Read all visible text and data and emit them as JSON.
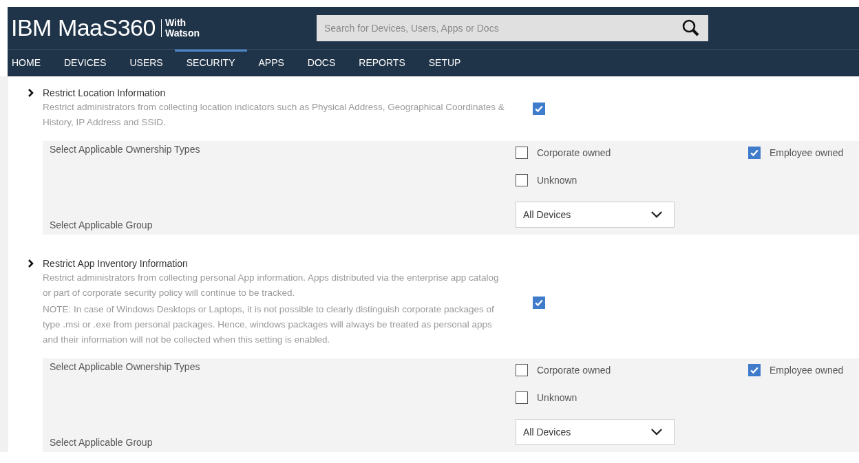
{
  "header": {
    "logo": "IBM MaaS360",
    "logo_sub": [
      "With",
      "Watson"
    ],
    "search": {
      "placeholder": "Search for Devices, Users, Apps or Docs"
    }
  },
  "nav": [
    {
      "label": "HOME",
      "selected": false
    },
    {
      "label": "DEVICES",
      "selected": false
    },
    {
      "label": "USERS",
      "selected": false
    },
    {
      "label": "SECURITY",
      "selected": true
    },
    {
      "label": "APPS",
      "selected": false
    },
    {
      "label": "DOCS",
      "selected": false
    },
    {
      "label": "REPORTS",
      "selected": false
    },
    {
      "label": "SETUP",
      "selected": false
    }
  ],
  "settings": [
    {
      "title": "Restrict Location Information",
      "description": [
        "Restrict administrators from collecting location indicators such as Physical Address, Geographical Coordinates & History, IP Address and SSID."
      ],
      "checked": true,
      "ownership_label": "Select Applicable Ownership Types",
      "ownership": [
        {
          "label": "Corporate owned",
          "checked": false
        },
        {
          "label": "Employee owned",
          "checked": true
        },
        {
          "label": "Unknown",
          "checked": false
        }
      ],
      "group_label": "Select Applicable Group",
      "group": "All Devices"
    },
    {
      "title": "Restrict App Inventory Information",
      "description": [
        "Restrict administrators from collecting personal App information. Apps distributed via the enterprise app catalog or part of corporate security policy will continue to be tracked.",
        "NOTE: In case of Windows Desktops or Laptops, it is not possible to clearly distinguish corporate packages of type .msi or .exe from personal packages. Hence, windows packages will always be treated as personal apps and their information will not be collected when this setting is enabled."
      ],
      "checked": true,
      "ownership_label": "Select Applicable Ownership Types",
      "ownership": [
        {
          "label": "Corporate owned",
          "checked": false
        },
        {
          "label": "Employee owned",
          "checked": true
        },
        {
          "label": "Unknown",
          "checked": false
        }
      ],
      "group_label": "Select Applicable Group",
      "group": "All Devices"
    }
  ]
}
